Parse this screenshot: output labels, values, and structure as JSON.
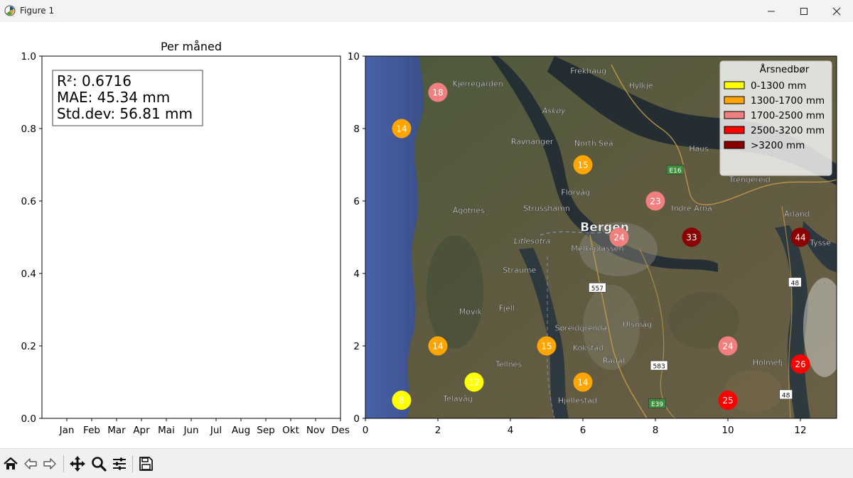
{
  "window": {
    "title": "Figure 1",
    "icons": [
      "matplotlib-icon",
      "minimize-icon",
      "maximize-icon",
      "close-icon"
    ]
  },
  "toolbar": {
    "icons": [
      "home-icon",
      "back-icon",
      "forward-icon",
      "pan-icon",
      "zoom-icon",
      "configure-subplots-icon",
      "save-icon"
    ]
  },
  "chart_data": [
    {
      "type": "line",
      "title": "Per måned",
      "xlabel": "",
      "ylabel": "",
      "categories": [
        "Jan",
        "Feb",
        "Mar",
        "Apr",
        "Mai",
        "Jun",
        "Jul",
        "Aug",
        "Sep",
        "Okt",
        "Nov",
        "Des"
      ],
      "ylim": [
        0,
        1.0
      ],
      "yticks": [
        "0.0",
        "0.2",
        "0.4",
        "0.6",
        "0.8",
        "1.0"
      ],
      "series": [],
      "annotation_lines": [
        "R²: 0.6716",
        "MAE: 45.34 mm",
        "Std.dev: 56.81 mm"
      ],
      "grid": false
    },
    {
      "type": "scatter",
      "title": "",
      "background": "satellite map of the Bergen area",
      "xlim": [
        0,
        13
      ],
      "ylim": [
        0,
        10
      ],
      "xticks": [
        "0",
        "2",
        "4",
        "6",
        "8",
        "10",
        "12"
      ],
      "yticks": [
        "0",
        "2",
        "4",
        "6",
        "8",
        "10"
      ],
      "legend": {
        "title": "Årsnedbør",
        "position": "top-right",
        "entries": [
          {
            "label": "0-1300 mm",
            "color": "#ffff00"
          },
          {
            "label": "1300-1700 mm",
            "color": "#ffa500"
          },
          {
            "label": "1700-2500 mm",
            "color": "#f08080"
          },
          {
            "label": "2500-3200 mm",
            "color": "#ff0000"
          },
          {
            "label": ">3200 mm",
            "color": "#8b0000"
          }
        ]
      },
      "points": [
        {
          "x": 1,
          "y": 0.5,
          "label": "8",
          "color": "#ffff00"
        },
        {
          "x": 3,
          "y": 1,
          "label": "12",
          "color": "#ffff00"
        },
        {
          "x": 1,
          "y": 8,
          "label": "14",
          "color": "#ffa500"
        },
        {
          "x": 2,
          "y": 2,
          "label": "14",
          "color": "#ffa500"
        },
        {
          "x": 5,
          "y": 2,
          "label": "15",
          "color": "#ffa500"
        },
        {
          "x": 6,
          "y": 1,
          "label": "14",
          "color": "#ffa500"
        },
        {
          "x": 6,
          "y": 7,
          "label": "15",
          "color": "#ffa500"
        },
        {
          "x": 2,
          "y": 9,
          "label": "18",
          "color": "#f08080"
        },
        {
          "x": 7,
          "y": 5,
          "label": "24",
          "color": "#f08080"
        },
        {
          "x": 8,
          "y": 6,
          "label": "23",
          "color": "#f08080"
        },
        {
          "x": 10,
          "y": 2,
          "label": "24",
          "color": "#f08080"
        },
        {
          "x": 10,
          "y": 0.5,
          "label": "25",
          "color": "#ff0000"
        },
        {
          "x": 12,
          "y": 1.5,
          "label": "26",
          "color": "#ff0000"
        },
        {
          "x": 9,
          "y": 5,
          "label": "33",
          "color": "#8b0000"
        },
        {
          "x": 12,
          "y": 5,
          "label": "44",
          "color": "#8b0000"
        }
      ]
    }
  ],
  "map_labels": [
    {
      "text": "Frekhaug",
      "x": 6.15,
      "y": 9.6
    },
    {
      "text": "Kjerregarden",
      "x": 3.1,
      "y": 9.25
    },
    {
      "text": "Hylkje",
      "x": 7.6,
      "y": 9.2
    },
    {
      "text": "Askøy",
      "x": 5.2,
      "y": 8.5
    },
    {
      "text": "Ravnanger",
      "x": 4.6,
      "y": 7.65
    },
    {
      "text": "North Sea",
      "x": 6.3,
      "y": 7.6
    },
    {
      "text": "Haus",
      "x": 9.2,
      "y": 7.45
    },
    {
      "text": "E16",
      "x": 8.55,
      "y": 6.85
    },
    {
      "text": "Trengereid",
      "x": 10.6,
      "y": 6.6
    },
    {
      "text": "Florvåg",
      "x": 5.8,
      "y": 6.25
    },
    {
      "text": "Indre Arna",
      "x": 9.0,
      "y": 5.8
    },
    {
      "text": "Ågotnes",
      "x": 2.85,
      "y": 5.75
    },
    {
      "text": "Strusshamn",
      "x": 5.0,
      "y": 5.8
    },
    {
      "text": "Bergen",
      "x": 6.6,
      "y": 5.25
    },
    {
      "text": "Årland",
      "x": 11.9,
      "y": 5.65
    },
    {
      "text": "Litlesotra",
      "x": 4.6,
      "y": 4.9
    },
    {
      "text": "Melkeplassen",
      "x": 6.4,
      "y": 4.7
    },
    {
      "text": "Tysse",
      "x": 12.55,
      "y": 4.85
    },
    {
      "text": "Straume",
      "x": 4.25,
      "y": 4.1
    },
    {
      "text": "557",
      "x": 6.4,
      "y": 3.6
    },
    {
      "text": "48",
      "x": 11.85,
      "y": 3.75
    },
    {
      "text": "Fjell",
      "x": 3.9,
      "y": 3.05
    },
    {
      "text": "Møvik",
      "x": 2.9,
      "y": 2.95
    },
    {
      "text": "Ulsmåg",
      "x": 7.5,
      "y": 2.6
    },
    {
      "text": "Søreidgrenda",
      "x": 5.95,
      "y": 2.5
    },
    {
      "text": "Kokstad",
      "x": 6.15,
      "y": 1.95
    },
    {
      "text": "Rådal",
      "x": 6.85,
      "y": 1.6
    },
    {
      "text": "Tellnes",
      "x": 3.95,
      "y": 1.5
    },
    {
      "text": "583",
      "x": 8.1,
      "y": 1.45
    },
    {
      "text": "Holmefj",
      "x": 11.1,
      "y": 1.55
    },
    {
      "text": "Telavåg",
      "x": 2.55,
      "y": 0.55
    },
    {
      "text": "Hjellestad",
      "x": 5.85,
      "y": 0.5
    },
    {
      "text": "48",
      "x": 11.6,
      "y": 0.65
    },
    {
      "text": "E39",
      "x": 8.05,
      "y": 0.4
    }
  ]
}
